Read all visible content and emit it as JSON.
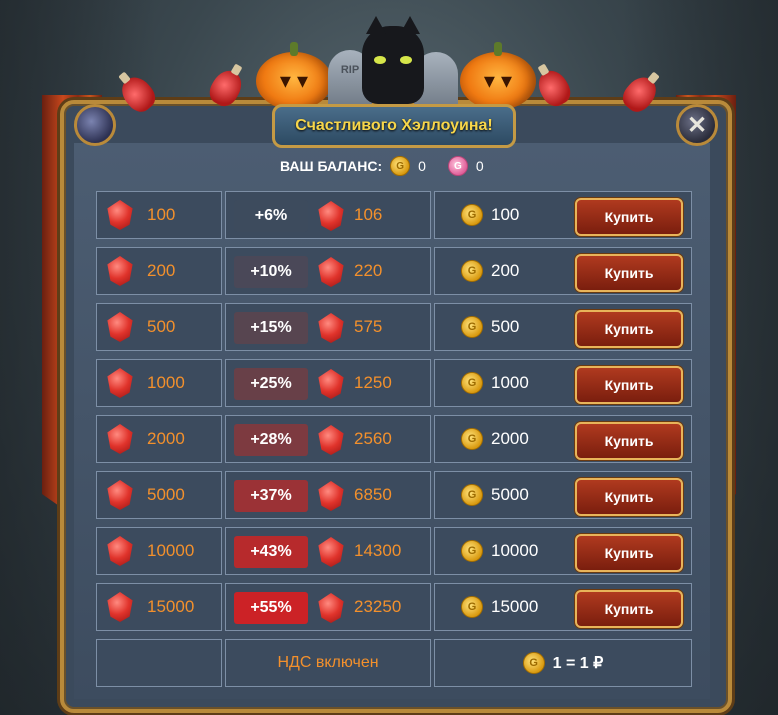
{
  "title": "Счастливого Хэллоуина!",
  "balance": {
    "label": "ВАШ БАЛАНС:",
    "coins": "0",
    "gems": "0"
  },
  "icons": {
    "coin_letter": "G",
    "gem_letter": "G",
    "close_glyph": "✕",
    "tomb_text": "RIP"
  },
  "packs": [
    {
      "base": "100",
      "bonus": "+6%",
      "total": "106",
      "price": "100",
      "buy": "Купить",
      "bonus_color": "#3d4b5d"
    },
    {
      "base": "200",
      "bonus": "+10%",
      "total": "220",
      "price": "200",
      "buy": "Купить",
      "bonus_color": "#4a4858"
    },
    {
      "base": "500",
      "bonus": "+15%",
      "total": "575",
      "price": "500",
      "buy": "Купить",
      "bonus_color": "#574550"
    },
    {
      "base": "1000",
      "bonus": "+25%",
      "total": "1250",
      "price": "1000",
      "buy": "Купить",
      "bonus_color": "#684048"
    },
    {
      "base": "2000",
      "bonus": "+28%",
      "total": "2560",
      "price": "2000",
      "buy": "Купить",
      "bonus_color": "#7d3a40"
    },
    {
      "base": "5000",
      "bonus": "+37%",
      "total": "6850",
      "price": "5000",
      "buy": "Купить",
      "bonus_color": "#9b3236"
    },
    {
      "base": "10000",
      "bonus": "+43%",
      "total": "14300",
      "price": "10000",
      "buy": "Купить",
      "bonus_color": "#b72a2c"
    },
    {
      "base": "15000",
      "bonus": "+55%",
      "total": "23250",
      "price": "15000",
      "buy": "Купить",
      "bonus_color": "#cc2226"
    }
  ],
  "footer": {
    "vat": "НДС включен",
    "rate": "1 = 1 ₽"
  }
}
